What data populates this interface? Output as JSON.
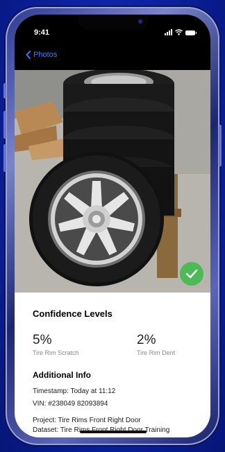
{
  "status_bar": {
    "time": "9:41"
  },
  "nav": {
    "back_label": "Photos"
  },
  "colors": {
    "accent": "#3a7df7",
    "success": "#4cbb55"
  },
  "confidence": {
    "title": "Confidence Levels",
    "metrics": [
      {
        "value": "5%",
        "label": "Tire Rim Scratch"
      },
      {
        "value": "2%",
        "label": "Tire Rim Dent"
      }
    ]
  },
  "additional": {
    "title": "Additional Info",
    "timestamp": "Timestamp: Today at 11:12",
    "vin": "VIN: #238049 82093894",
    "project": "Project: Tire Rims Front Right Door",
    "dataset": "Dataset: Tire Rims Front Right Door Training"
  },
  "icons": {
    "back": "chevron-left-icon",
    "check": "checkmark-icon",
    "signal": "cellular-signal-icon",
    "wifi": "wifi-icon",
    "battery": "battery-icon"
  }
}
